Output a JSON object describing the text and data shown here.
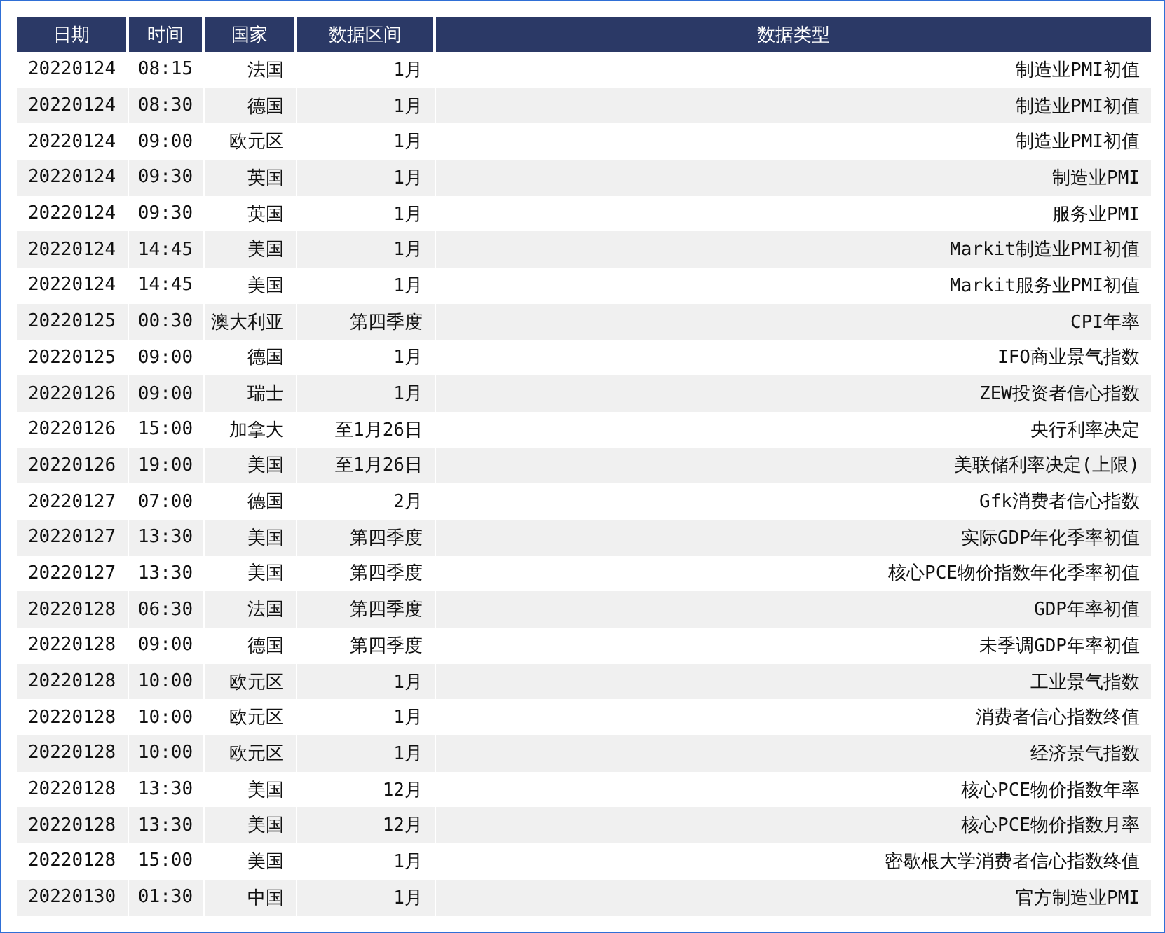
{
  "table": {
    "columns": [
      "日期",
      "时间",
      "国家",
      "数据区间",
      "数据类型"
    ],
    "rows": [
      [
        "20220124",
        "08:15",
        "法国",
        "1月",
        "制造业PMI初值"
      ],
      [
        "20220124",
        "08:30",
        "德国",
        "1月",
        "制造业PMI初值"
      ],
      [
        "20220124",
        "09:00",
        "欧元区",
        "1月",
        "制造业PMI初值"
      ],
      [
        "20220124",
        "09:30",
        "英国",
        "1月",
        "制造业PMI"
      ],
      [
        "20220124",
        "09:30",
        "英国",
        "1月",
        "服务业PMI"
      ],
      [
        "20220124",
        "14:45",
        "美国",
        "1月",
        "Markit制造业PMI初值"
      ],
      [
        "20220124",
        "14:45",
        "美国",
        "1月",
        "Markit服务业PMI初值"
      ],
      [
        "20220125",
        "00:30",
        "澳大利亚",
        "第四季度",
        "CPI年率"
      ],
      [
        "20220125",
        "09:00",
        "德国",
        "1月",
        "IFO商业景气指数"
      ],
      [
        "20220126",
        "09:00",
        "瑞士",
        "1月",
        "ZEW投资者信心指数"
      ],
      [
        "20220126",
        "15:00",
        "加拿大",
        "至1月26日",
        "央行利率决定"
      ],
      [
        "20220126",
        "19:00",
        "美国",
        "至1月26日",
        "美联储利率决定(上限)"
      ],
      [
        "20220127",
        "07:00",
        "德国",
        "2月",
        "Gfk消费者信心指数"
      ],
      [
        "20220127",
        "13:30",
        "美国",
        "第四季度",
        "实际GDP年化季率初值"
      ],
      [
        "20220127",
        "13:30",
        "美国",
        "第四季度",
        "核心PCE物价指数年化季率初值"
      ],
      [
        "20220128",
        "06:30",
        "法国",
        "第四季度",
        "GDP年率初值"
      ],
      [
        "20220128",
        "09:00",
        "德国",
        "第四季度",
        "未季调GDP年率初值"
      ],
      [
        "20220128",
        "10:00",
        "欧元区",
        "1月",
        "工业景气指数"
      ],
      [
        "20220128",
        "10:00",
        "欧元区",
        "1月",
        "消费者信心指数终值"
      ],
      [
        "20220128",
        "10:00",
        "欧元区",
        "1月",
        "经济景气指数"
      ],
      [
        "20220128",
        "13:30",
        "美国",
        "12月",
        "核心PCE物价指数年率"
      ],
      [
        "20220128",
        "13:30",
        "美国",
        "12月",
        "核心PCE物价指数月率"
      ],
      [
        "20220128",
        "15:00",
        "美国",
        "1月",
        "密歇根大学消费者信心指数终值"
      ],
      [
        "20220130",
        "01:30",
        "中国",
        "1月",
        "官方制造业PMI"
      ]
    ]
  }
}
